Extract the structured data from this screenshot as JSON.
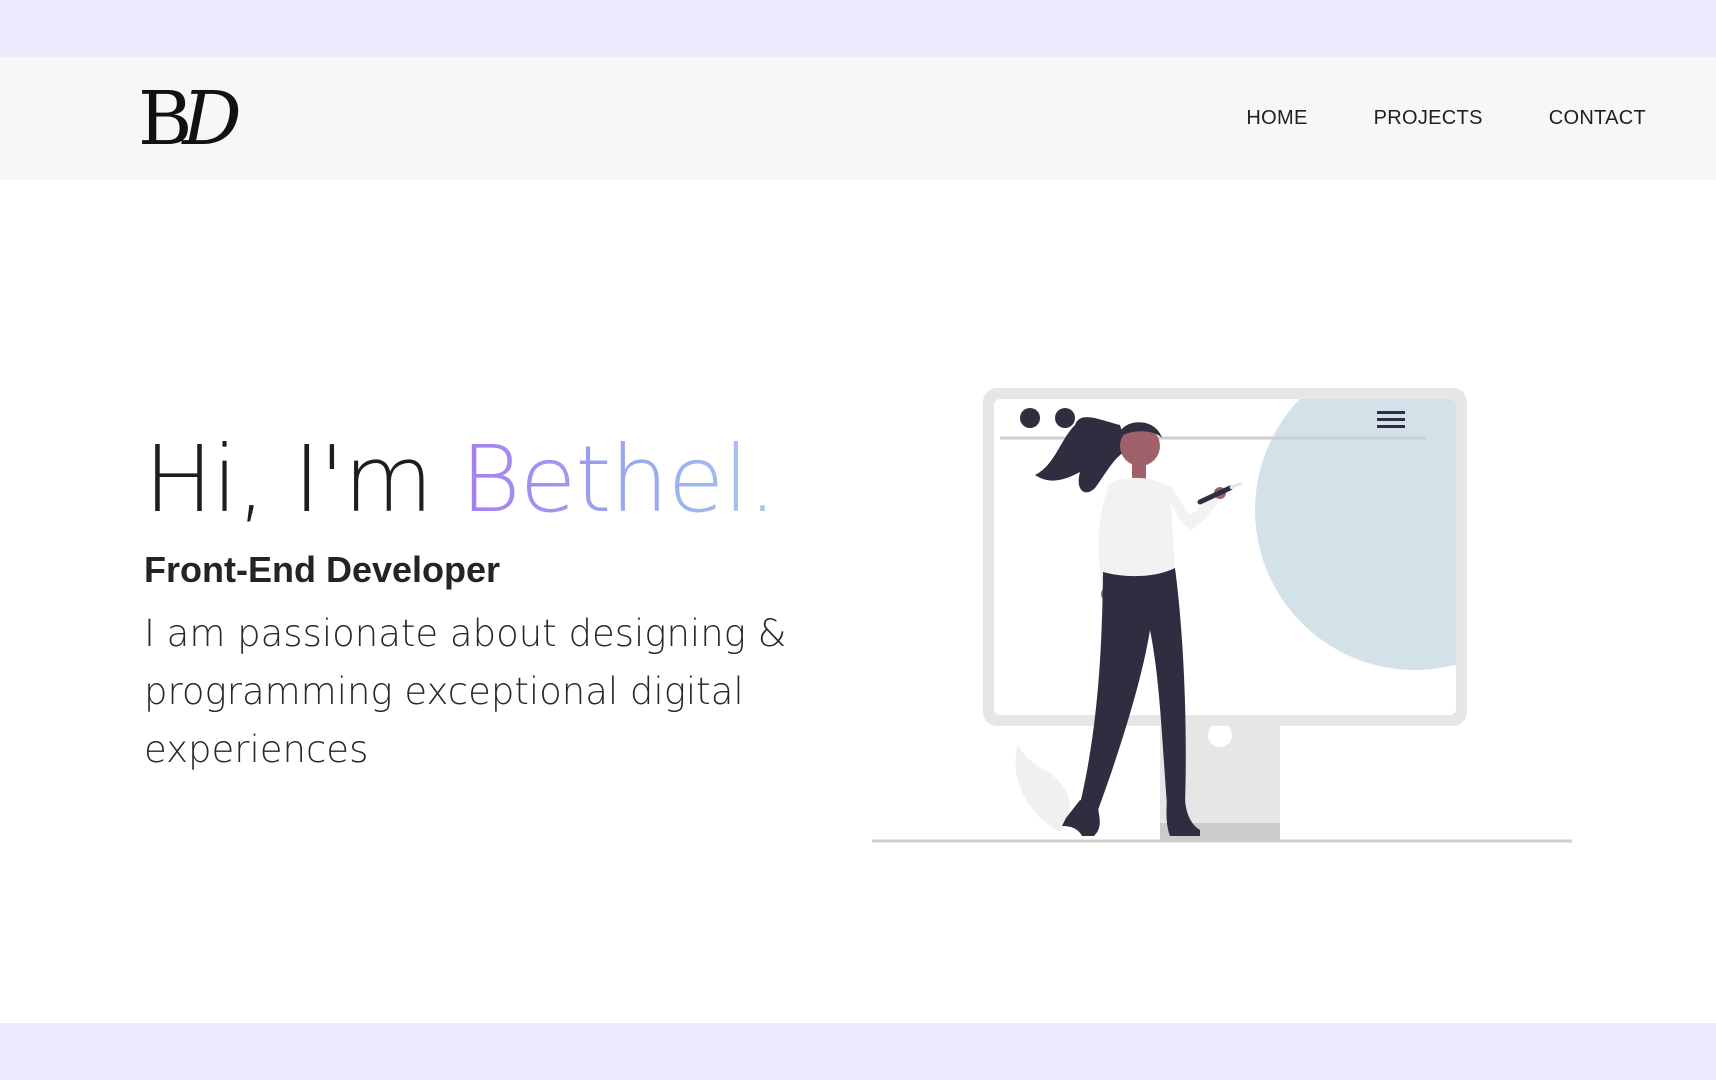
{
  "logo": {
    "text_b": "B",
    "text_d": "D"
  },
  "nav": {
    "items": [
      {
        "label": "HOME"
      },
      {
        "label": "PROJECTS"
      },
      {
        "label": "CONTACT"
      }
    ]
  },
  "hero": {
    "greeting": "Hi, I'm ",
    "name": "Bethel.",
    "role": "Front-End Developer",
    "tagline": "I am passionate about designing & programming exceptional digital experiences"
  },
  "colors": {
    "band": "#ebebfd",
    "navbar_bg": "#f7f7f7",
    "name_gradient_start": "#a67ff0",
    "name_gradient_end": "#a4c8ee",
    "text_dark": "#1d1d22",
    "illustration_circle": "#d3e1e8",
    "illustration_dark": "#2f2e41"
  },
  "icons": {
    "logo": "bd-monogram-logo",
    "illustration": "woman-drawing-on-monitor-illustration",
    "hamburger": "hamburger-menu-icon"
  }
}
